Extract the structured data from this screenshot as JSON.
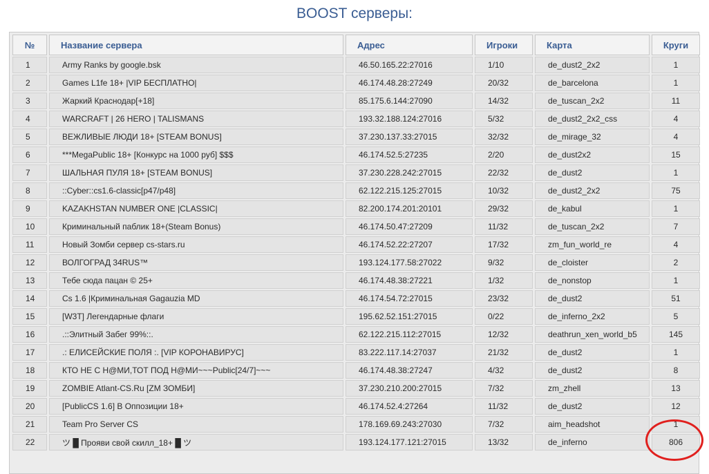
{
  "page": {
    "title": "BOOST серверы:"
  },
  "table": {
    "headers": {
      "num": "№",
      "name": "Название сервера",
      "address": "Адрес",
      "players": "Игроки",
      "map": "Карта",
      "laps": "Круги"
    },
    "rows": [
      {
        "num": "1",
        "name": "Army Ranks by google.bsk",
        "address": "46.50.165.22:27016",
        "players": "1/10",
        "map": "de_dust2_2x2",
        "laps": "1"
      },
      {
        "num": "2",
        "name": "Games L1fe 18+ |VIP БЕСПЛАТНО|",
        "address": "46.174.48.28:27249",
        "players": "20/32",
        "map": "de_barcelona",
        "laps": "1"
      },
      {
        "num": "3",
        "name": "Жаркий Краснодар[+18]",
        "address": "85.175.6.144:27090",
        "players": "14/32",
        "map": "de_tuscan_2x2",
        "laps": "11"
      },
      {
        "num": "4",
        "name": "WARCRAFT | 26 HERO | TALISMANS",
        "address": "193.32.188.124:27016",
        "players": "5/32",
        "map": "de_dust2_2x2_css",
        "laps": "4"
      },
      {
        "num": "5",
        "name": "ВЕЖЛИВЫЕ ЛЮДИ 18+ [STEAM BONUS]",
        "address": "37.230.137.33:27015",
        "players": "32/32",
        "map": "de_mirage_32",
        "laps": "4"
      },
      {
        "num": "6",
        "name": "***MegaPublic 18+ [Конкурс на 1000 руб] $$$",
        "address": "46.174.52.5:27235",
        "players": "2/20",
        "map": "de_dust2x2",
        "laps": "15"
      },
      {
        "num": "7",
        "name": "ШАЛЬНАЯ ПУЛЯ 18+ [STEAM BONUS]",
        "address": "37.230.228.242:27015",
        "players": "22/32",
        "map": "de_dust2",
        "laps": "1"
      },
      {
        "num": "8",
        "name": "::Cyber::cs1.6-classic[p47/p48]",
        "address": "62.122.215.125:27015",
        "players": "10/32",
        "map": "de_dust2_2x2",
        "laps": "75"
      },
      {
        "num": "9",
        "name": "KAZAKHSTAN NUMBER ONE |CLASSIC|",
        "address": "82.200.174.201:20101",
        "players": "29/32",
        "map": "de_kabul",
        "laps": "1"
      },
      {
        "num": "10",
        "name": "Криминальный паблик 18+(Steam Bonus)",
        "address": "46.174.50.47:27209",
        "players": "11/32",
        "map": "de_tuscan_2x2",
        "laps": "7"
      },
      {
        "num": "11",
        "name": "Новый Зомби сервер cs-stars.ru",
        "address": "46.174.52.22:27207",
        "players": "17/32",
        "map": "zm_fun_world_re",
        "laps": "4"
      },
      {
        "num": "12",
        "name": "ВОЛГОГРАД 34RUS™",
        "address": "193.124.177.58:27022",
        "players": "9/32",
        "map": "de_cloister",
        "laps": "2"
      },
      {
        "num": "13",
        "name": "Тебе сюда пацан © 25+",
        "address": "46.174.48.38:27221",
        "players": "1/32",
        "map": "de_nonstop",
        "laps": "1"
      },
      {
        "num": "14",
        "name": "Cs 1.6 |Криминальная Gagauzia MD",
        "address": "46.174.54.72:27015",
        "players": "23/32",
        "map": "de_dust2",
        "laps": "51"
      },
      {
        "num": "15",
        "name": "[W3T] Легендарные флаги",
        "address": "195.62.52.151:27015",
        "players": "0/22",
        "map": "de_inferno_2x2",
        "laps": "5"
      },
      {
        "num": "16",
        "name": ".::Элитный Забег 99%::.",
        "address": "62.122.215.112:27015",
        "players": "12/32",
        "map": "deathrun_xen_world_b5",
        "laps": "145"
      },
      {
        "num": "17",
        "name": ".: ЕЛИСЕЙСКИЕ ПОЛЯ :. [VIP КОРОНАВИРУС]",
        "address": "83.222.117.14:27037",
        "players": "21/32",
        "map": "de_dust2",
        "laps": "1"
      },
      {
        "num": "18",
        "name": "КТО НЕ С Н@МИ,ТОТ ПОД Н@МИ~~~Public[24/7]~~~",
        "address": "46.174.48.38:27247",
        "players": "4/32",
        "map": "de_dust2",
        "laps": "8"
      },
      {
        "num": "19",
        "name": "ZOMBIE Atlant-CS.Ru [ZM ЗОМБИ]",
        "address": "37.230.210.200:27015",
        "players": "7/32",
        "map": "zm_zhell",
        "laps": "13"
      },
      {
        "num": "20",
        "name": "[PublicCS 1.6] В Оппозиции 18+",
        "address": "46.174.52.4:27264",
        "players": "11/32",
        "map": "de_dust2",
        "laps": "12"
      },
      {
        "num": "21",
        "name": "Team Pro Server CS",
        "address": "178.169.69.243:27030",
        "players": "7/32",
        "map": "aim_headshot",
        "laps": "1"
      },
      {
        "num": "22",
        "name": "ツ █ Прояви свой скилл_18+ █ ツ",
        "address": "193.124.177.121:27015",
        "players": "13/32",
        "map": "de_inferno",
        "laps": "806"
      }
    ]
  },
  "annotation": {
    "color": "#e0201e"
  }
}
